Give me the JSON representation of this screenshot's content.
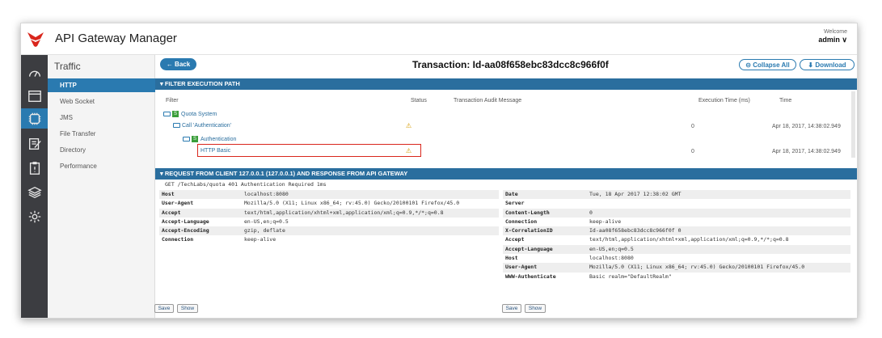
{
  "app": {
    "title": "API Gateway Manager",
    "welcome": "Welcome",
    "user": "admin ∨"
  },
  "sidebar_icons": [
    "dashboard-icon",
    "window-icon",
    "network-icon",
    "edit-icon",
    "clipboard-icon",
    "layers-icon",
    "gear-icon"
  ],
  "subnav": {
    "title": "Traffic",
    "items": [
      "HTTP",
      "Web Socket",
      "JMS",
      "File Transfer",
      "Directory",
      "Performance"
    ]
  },
  "toolbar": {
    "back": "← Back",
    "title": "Transaction: Id-aa08f658ebc83dcc8c966f0f",
    "collapse": "⊝ Collapse All",
    "download": "⬇ Download"
  },
  "filter_section": {
    "heading": "▾ FILTER EXECUTION PATH",
    "columns": [
      "Filter",
      "Status",
      "Transaction Audit Message",
      "Execution Time (ms)",
      "Time"
    ],
    "rows": [
      {
        "name": "Quota System",
        "status": "",
        "exec": "",
        "time": ""
      },
      {
        "name": "Call 'Authentication'",
        "status": "⚠",
        "exec": "0",
        "time": "Apr 18, 2017, 14:38:02.949"
      },
      {
        "name": "Authentication",
        "status": "",
        "exec": "",
        "time": ""
      },
      {
        "name": "HTTP Basic",
        "status": "⚠",
        "exec": "0",
        "time": "Apr 18, 2017, 14:38:02.949"
      }
    ]
  },
  "request_section": {
    "heading": "▾ REQUEST FROM CLIENT 127.0.0.1 (127.0.0.1) AND RESPONSE FROM API GATEWAY",
    "request_line": "GET /TechLabs/quota 401 Authentication Required 1ms",
    "request_headers": [
      {
        "k": "Host",
        "v": "localhost:8080"
      },
      {
        "k": "User-Agent",
        "v": "Mozilla/5.0 (X11; Linux x86_64; rv:45.0) Gecko/20100101 Firefox/45.0"
      },
      {
        "k": "Accept",
        "v": "text/html,application/xhtml+xml,application/xml;q=0.9,*/*;q=0.8"
      },
      {
        "k": "Accept-Language",
        "v": "en-US,en;q=0.5"
      },
      {
        "k": "Accept-Encoding",
        "v": "gzip, deflate"
      },
      {
        "k": "Connection",
        "v": "keep-alive"
      }
    ],
    "response_headers": [
      {
        "k": "Date",
        "v": "Tue, 18 Apr 2017 12:38:02 GMT"
      },
      {
        "k": "Server",
        "v": ""
      },
      {
        "k": "Content-Length",
        "v": "0"
      },
      {
        "k": "Connection",
        "v": "keep-alive"
      },
      {
        "k": "X-CorrelationID",
        "v": "Id-aa08f658ebc83dcc8c966f0f 0"
      },
      {
        "k": "Accept",
        "v": "text/html,application/xhtml+xml,application/xml;q=0.9,*/*;q=0.8"
      },
      {
        "k": "Accept-Language",
        "v": "en-US,en;q=0.5"
      },
      {
        "k": "Host",
        "v": "localhost:8080"
      },
      {
        "k": "User-Agent",
        "v": "Mozilla/5.0 (X11; Linux x86_64; rv:45.0) Gecko/20100101 Firefox/45.0"
      },
      {
        "k": "WWW-Authenticate",
        "v": "Basic realm=\"DefaultRealm\""
      }
    ],
    "save": "Save",
    "show": "Show"
  },
  "colors": {
    "accent": "#2a7ab0",
    "section_header": "#2a6e9e",
    "sidebar": "#3c3d41",
    "warning": "#d69b00",
    "highlight": "#d9261c"
  }
}
